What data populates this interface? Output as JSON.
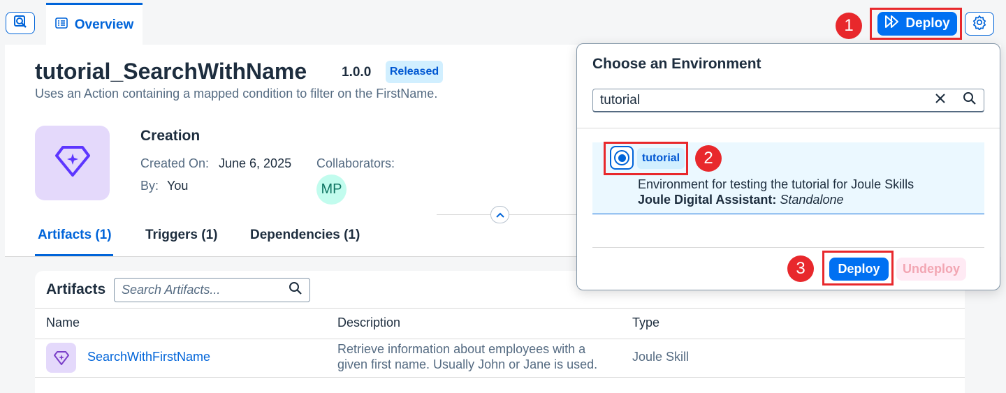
{
  "header": {
    "tab_overview": "Overview",
    "deploy_label": "Deploy",
    "step1": "1"
  },
  "skill": {
    "title": "tutorial_SearchWithName",
    "version": "1.0.0",
    "status": "Released",
    "description": "Uses an Action containing a mapped condition to filter on the FirstName."
  },
  "creation": {
    "heading": "Creation",
    "created_on_label": "Created On:",
    "created_on_value": "June 6, 2025",
    "by_label": "By:",
    "by_value": "You",
    "collaborators_label": "Collaborators:",
    "collaborator_initials": "MP"
  },
  "tabs": [
    {
      "label": "Artifacts (1)"
    },
    {
      "label": "Triggers (1)"
    },
    {
      "label": "Dependencies (1)"
    }
  ],
  "artifacts": {
    "title": "Artifacts",
    "search_placeholder": "Search Artifacts...",
    "columns": [
      "Name",
      "Description",
      "Type"
    ],
    "rows": [
      {
        "name": "SearchWithFirstName",
        "description_line1": "Retrieve information about employees with a",
        "description_line2": "given first name. Usually John or Jane is used.",
        "type": "Joule Skill"
      }
    ]
  },
  "popover": {
    "title": "Choose an Environment",
    "search_value": "tutorial",
    "step2": "2",
    "step3": "3",
    "environment": {
      "tag": "tutorial",
      "description": "Environment for testing the tutorial for Joule Skills",
      "assistant_label": "Joule Digital Assistant:",
      "assistant_value": "Standalone"
    },
    "deploy_label": "Deploy",
    "undeploy_label": "Undeploy"
  },
  "colors": {
    "brand_blue": "#0070f2",
    "link_blue": "#0064d9",
    "annotation_red": "#e8282c"
  }
}
